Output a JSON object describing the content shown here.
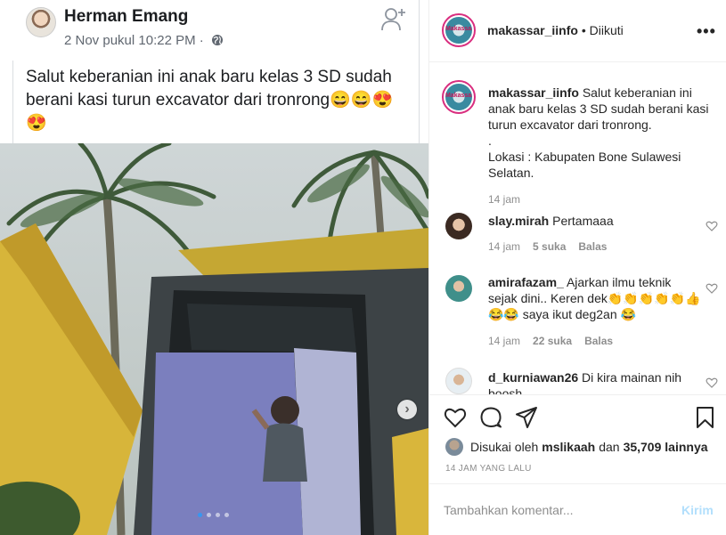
{
  "facebook": {
    "author": "Herman Emang",
    "date": "2 Nov pukul 10:22 PM · ",
    "post_text": "Salut keberanian ini anak baru kelas 3 SD sudah berani kasi turun excavator dari tronrong😄😄😍😍",
    "icons": {
      "add_friend": "add-user-icon",
      "audience": "globe-icon",
      "next": "chevron-right-icon"
    },
    "carousel_dots": 4,
    "carousel_active": 1
  },
  "instagram": {
    "username": "makassar_iinfo",
    "follow_status": " • Diikuti",
    "avatar_text": "Makassar",
    "caption": {
      "username": "makassar_iinfo",
      "text": " Salut keberanian ini anak baru kelas 3 SD sudah berani kasi turun excavator dari tronrong.",
      "dot": ".",
      "location": "Lokasi : Kabupaten Bone Sulawesi Selatan.",
      "time": "14 jam"
    },
    "comments": [
      {
        "username": "slay.mirah",
        "text": " Pertamaaa",
        "time": "14 jam",
        "likes": "5 suka",
        "reply": "Balas"
      },
      {
        "username": "amirafazam_",
        "text": " Ajarkan ilmu teknik sejak dini.. Keren dek👏👏👏👏👏👍😂😂 saya ikut deg2an 😂",
        "time": "14 jam",
        "likes": "22 suka",
        "reply": "Balas"
      },
      {
        "username": "d_kurniawan26",
        "text": " Di kira mainan nih boosh"
      }
    ],
    "liked_by_prefix": "Disukai oleh",
    "liked_by_user": "mslikaah",
    "liked_by_mid": "dan",
    "liked_by_count": "35,709 lainnya",
    "posted_ago": "14 JAM YANG LALU",
    "comment_placeholder": "Tambahkan komentar...",
    "send_label": "Kirim",
    "more_label": "•••",
    "colors": {
      "ring": "#d92e7f",
      "send_disabled": "#b2dffc",
      "meta": "#8e8e8e"
    }
  }
}
